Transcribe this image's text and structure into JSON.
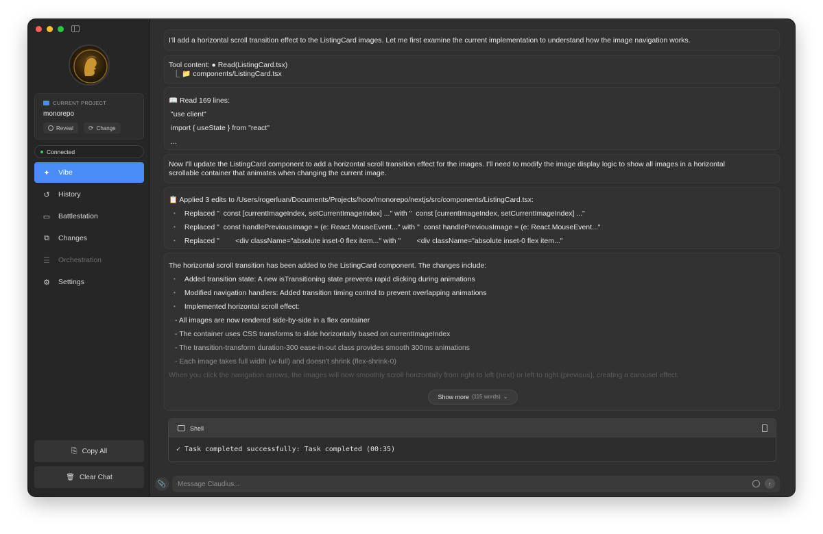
{
  "sidebar": {
    "project": {
      "label": "CURRENT PROJECT",
      "name": "monorepo",
      "reveal_label": "Reveal",
      "change_label": "Change"
    },
    "status": "Connected",
    "nav": [
      {
        "label": "Vibe",
        "icon": "sparkle-icon",
        "active": true
      },
      {
        "label": "History",
        "icon": "history-icon"
      },
      {
        "label": "Battlestation",
        "icon": "monitor-icon"
      },
      {
        "label": "Changes",
        "icon": "diff-icon"
      },
      {
        "label": "Orchestration",
        "icon": "layers-icon",
        "disabled": true
      },
      {
        "label": "Settings",
        "icon": "gear-icon"
      }
    ],
    "copy_all_label": "Copy All",
    "clear_chat_label": "Clear Chat"
  },
  "messages": {
    "m1": "I'll add a horizontal scroll transition effect to the ListingCard images. Let me first examine the current implementation to understand how the image navigation works.",
    "m2": {
      "line1": "Tool content: ● Read(ListingCard.tsx)",
      "line2": "  ⎿ 📁 components/ListingCard.tsx"
    },
    "m3": {
      "header": "📖 Read 169 lines:",
      "lines": [
        " \"use client\"",
        " import { useState } from \"react\"",
        " ..."
      ]
    },
    "m4": {
      "line1": "Now I'll update the ListingCard component to add a horizontal scroll transition effect for the images. I'll need to modify the image display logic to show all images in a horizontal",
      "line2": "scrollable container that animates when changing the current image."
    },
    "m5": {
      "header": "📋 Applied 3 edits to /Users/rogerluan/Documents/Projects/hoov/monorepo/nextjs/src/components/ListingCard.tsx:",
      "items": [
        "Replaced \"  const [currentImageIndex, setCurrentImageIndex] ...\" with \"  const [currentImageIndex, setCurrentImageIndex] ...\"",
        "Replaced \"  const handlePreviousImage = (e: React.MouseEvent...\" with \"  const handlePreviousImage = (e: React.MouseEvent...\"",
        "Replaced \"        <div className=\"absolute inset-0 flex item...\" with \"        <div className=\"absolute inset-0 flex item...\""
      ]
    },
    "m6": {
      "intro": "The horizontal scroll transition has been added to the ListingCard component. The changes include:",
      "items": [
        "Added transition state: A new isTransitioning state prevents rapid clicking during animations",
        "Modified navigation handlers: Added transition timing control to prevent overlapping animations",
        "Implemented horizontal scroll effect:"
      ],
      "sub": [
        "- All images are now rendered side-by-side in a flex container",
        "- The container uses CSS transforms to slide horizontally based on currentImageIndex",
        "- The transition-transform duration-300 ease-in-out class provides smooth 300ms animations",
        "- Each image takes full width (w-full) and doesn't shrink (flex-shrink-0)"
      ],
      "outro": "When you click the navigation arrows, the images will now smoothly scroll horizontally from right to left (next) or left to right (previous), creating a carousel effect.",
      "show_more": "Show more",
      "show_more_count": "(115 words)"
    },
    "shell": {
      "title": "Shell",
      "output": "✓ Task completed successfully: Task completed (00:35)"
    }
  },
  "input": {
    "placeholder": "Message Claudius..."
  }
}
